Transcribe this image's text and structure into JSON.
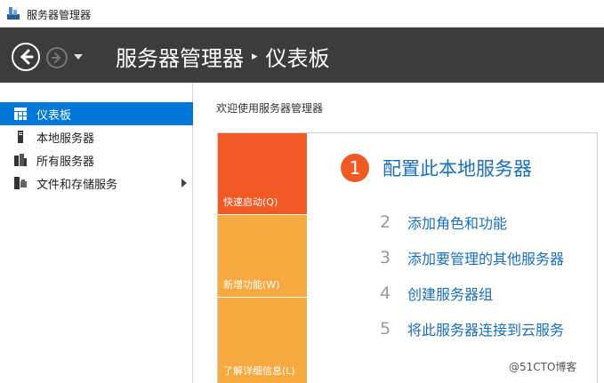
{
  "window": {
    "title": "服务器管理器"
  },
  "header": {
    "breadcrumb": [
      "服务器管理器",
      "仪表板"
    ],
    "separator": "▸"
  },
  "sidebar": {
    "items": [
      {
        "label": "仪表板",
        "icon": "dashboard-icon",
        "selected": true
      },
      {
        "label": "本地服务器",
        "icon": "local-server-icon",
        "selected": false
      },
      {
        "label": "所有服务器",
        "icon": "all-servers-icon",
        "selected": false
      },
      {
        "label": "文件和存储服务",
        "icon": "file-storage-icon",
        "selected": false,
        "has_submenu": true
      }
    ]
  },
  "main": {
    "welcome": "欢迎使用服务器管理器",
    "tiles": [
      {
        "label": "快速启动(Q)"
      },
      {
        "label": "新增功能(W)"
      },
      {
        "label": "了解详细信息(L)"
      }
    ],
    "primary_step": {
      "number": "1",
      "label": "配置此本地服务器"
    },
    "steps": [
      {
        "number": "2",
        "label": "添加角色和功能"
      },
      {
        "number": "3",
        "label": "添加要管理的其他服务器"
      },
      {
        "number": "4",
        "label": "创建服务器组"
      },
      {
        "number": "5",
        "label": "将此服务器连接到云服务"
      }
    ]
  },
  "watermark": "@51CTO博客",
  "colors": {
    "header_bg": "#3c3c3c",
    "selection": "#0078d7",
    "quick_start_tile": "#f15a24",
    "secondary_tile": "#f7a941",
    "link": "#1a6fba",
    "step_number": "#9a9a9a"
  }
}
